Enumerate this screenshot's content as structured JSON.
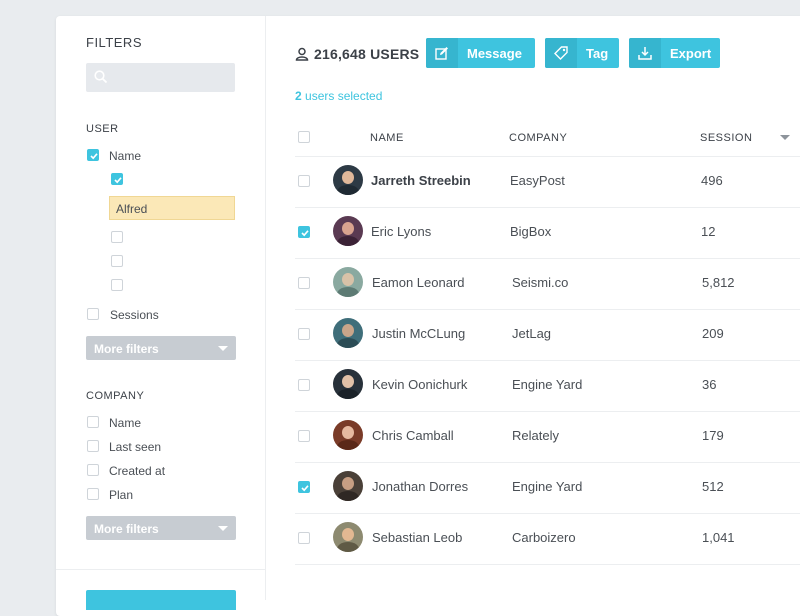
{
  "sidebar": {
    "title": "FILTERS",
    "search_placeholder": "",
    "user_section": {
      "title": "USER",
      "name_label": "Name",
      "name_checked": true,
      "sub_value": "Alfred",
      "sessions_label": "Sessions",
      "more_filters": "More filters"
    },
    "company_section": {
      "title": "COMPANY",
      "items": [
        "Name",
        "Last seen",
        "Created at",
        "Plan"
      ],
      "more_filters": "More filters"
    }
  },
  "header": {
    "user_count": "216,648 USERS",
    "buttons": {
      "message": "Message",
      "tag": "Tag",
      "export": "Export"
    },
    "selected_count": "2",
    "selected_suffix": " users selected"
  },
  "table": {
    "columns": {
      "name": "NAME",
      "company": "COMPANY",
      "session": "SESSION"
    },
    "rows": [
      {
        "name": "Jarreth Streebin",
        "company": "EasyPost",
        "session": "496",
        "checked": false
      },
      {
        "name": "Eric Lyons",
        "company": "BigBox",
        "session": "12",
        "checked": true
      },
      {
        "name": "Eamon Leonard",
        "company": "Seismi.co",
        "session": "5,812",
        "checked": false
      },
      {
        "name": "Justin McCLung",
        "company": "JetLag",
        "session": "209",
        "checked": false
      },
      {
        "name": "Kevin Oonichurk",
        "company": "Engine Yard",
        "session": "36",
        "checked": false
      },
      {
        "name": "Chris Camball",
        "company": "Relately",
        "session": "179",
        "checked": false
      },
      {
        "name": "Jonathan Dorres",
        "company": "Engine Yard",
        "session": "512",
        "checked": true
      },
      {
        "name": "Sebastian Leob",
        "company": "Carboizero",
        "session": "1,041",
        "checked": false
      }
    ]
  },
  "colors": {
    "accent": "#3ec4df",
    "highlight": "#fbe8b7",
    "muted_button": "#c7ccd2"
  }
}
